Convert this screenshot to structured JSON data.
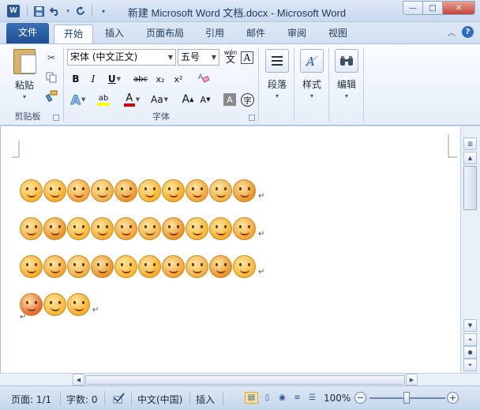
{
  "window": {
    "title": "新建 Microsoft Word 文档.docx  -  Microsoft Word",
    "app_icon": "W",
    "min_glyph": "—",
    "max_glyph": "□",
    "close_glyph": "✕"
  },
  "tabs": {
    "file": "文件",
    "items": [
      "开始",
      "插入",
      "页面布局",
      "引用",
      "邮件",
      "审阅",
      "视图"
    ],
    "help_glyph": "?"
  },
  "ribbon": {
    "clipboard": {
      "paste_label": "粘贴",
      "group_label": "剪贴板"
    },
    "font": {
      "font_name": "宋体 (中文正文)",
      "font_size": "五号",
      "phonetic_label": "wén",
      "phonetic_char": "文",
      "border_char": "A",
      "bold": "B",
      "italic": "I",
      "underline": "U",
      "strike": "abc",
      "subscript": "x₂",
      "superscript": "x²",
      "text_effect": "A",
      "highlight": "ab",
      "font_color": "A",
      "change_case": "Aa",
      "grow": "A",
      "shrink": "A",
      "shading_char": "A",
      "enclose_char": "字",
      "group_label": "字体"
    },
    "paragraph": {
      "label": "段落"
    },
    "styles": {
      "label": "样式"
    },
    "editing": {
      "label": "编辑"
    }
  },
  "document": {
    "emoji_rows": [
      10,
      10,
      10,
      3
    ]
  },
  "status": {
    "page": "页面: 1/1",
    "words": "字数: 0",
    "language": "中文(中国)",
    "insert": "插入",
    "zoom": "100%",
    "zoom_minus": "−",
    "zoom_plus": "+"
  },
  "colors": {
    "accent": "#2b5797",
    "file_tab": "#1f4f95",
    "emoji_fill": "#f7b733",
    "highlight": "#ffff00",
    "font_color_red": "#d00000"
  }
}
